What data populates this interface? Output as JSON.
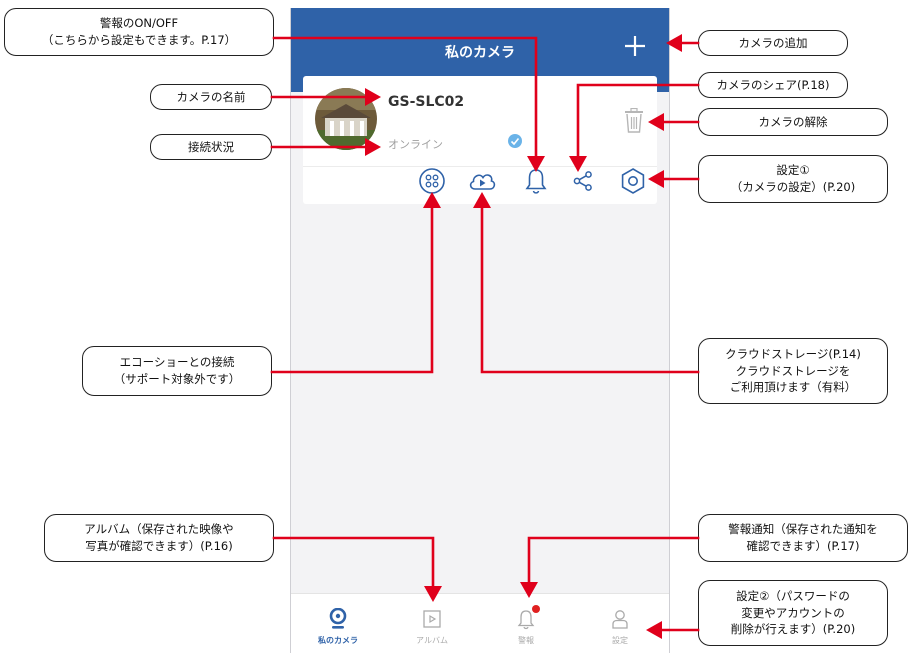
{
  "app": {
    "title": "私のカメラ",
    "camera": {
      "name": "GS-SLC02",
      "status": "オンライン"
    },
    "tabs": [
      {
        "label": "私のカメラ",
        "icon": "camera-icon",
        "active": true
      },
      {
        "label": "アルバム",
        "icon": "album-icon"
      },
      {
        "label": "警報",
        "icon": "bell-icon",
        "badge": true
      },
      {
        "label": "設定",
        "icon": "user-icon"
      }
    ],
    "colors": {
      "accent": "#2f62a8",
      "arrow": "#e0001b",
      "badge": "#e02020"
    }
  },
  "callouts": {
    "alarm_toggle": [
      "警報のON/OFF",
      "（こちらから設定もできます。P.17）"
    ],
    "camera_name": [
      "カメラの名前"
    ],
    "connection_status": [
      "接続状況"
    ],
    "add_camera": [
      "カメラの追加"
    ],
    "share_camera": [
      "カメラのシェア(P.18)"
    ],
    "remove_camera": [
      "カメラの解除"
    ],
    "settings1": [
      "設定①",
      "（カメラの設定）(P.20)"
    ],
    "echo_show": [
      "エコーショーとの接続",
      "（サポート対象外です）"
    ],
    "cloud_storage": [
      "クラウドストレージ(P.14)",
      "クラウドストレージを",
      "ご利用頂けます（有料）"
    ],
    "album": [
      "アルバム（保存された映像や",
      "写真が確認できます）(P.16)"
    ],
    "alarm_notification": [
      "警報通知（保存された通知を",
      "確認できます）(P.17)"
    ],
    "settings2": [
      "設定②（パスワードの",
      "変更やアカウントの",
      "削除が行えます）(P.20)"
    ]
  }
}
